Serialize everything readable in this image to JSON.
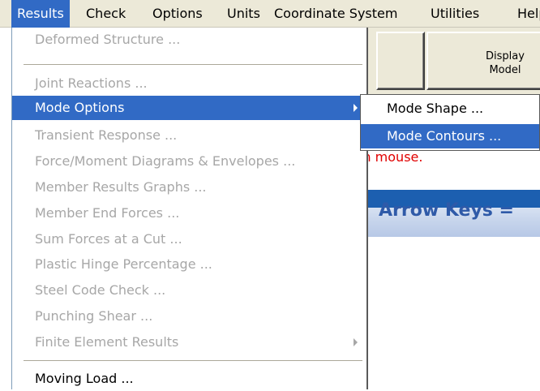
{
  "menubar": {
    "items": [
      "Results",
      "Check",
      "Options",
      "Units",
      "Coordinate System",
      "Utilities",
      "Help"
    ]
  },
  "toolbar": {
    "display_model_label_1": "Display",
    "display_model_label_2": "Model"
  },
  "hint": {
    "text": "m mouse."
  },
  "banner": {
    "text": "Arrow Keys ="
  },
  "results_menu": {
    "items": [
      {
        "label": "Deformed Structure ...",
        "enabled": false
      },
      {
        "label": "Joint Reactions ...",
        "enabled": false
      },
      {
        "label": "Mode Options",
        "enabled": true,
        "highlighted": true
      },
      {
        "label": "Transient Response ...",
        "enabled": false
      },
      {
        "label": "Force/Moment Diagrams & Envelopes ...",
        "enabled": false
      },
      {
        "label": "Member Results Graphs ...",
        "enabled": false
      },
      {
        "label": "Member End Forces ...",
        "enabled": false
      },
      {
        "label": "Sum Forces at a Cut ...",
        "enabled": false
      },
      {
        "label": "Plastic Hinge Percentage ...",
        "enabled": false
      },
      {
        "label": "Steel Code Check ...",
        "enabled": false
      },
      {
        "label": "Punching Shear ...",
        "enabled": false
      },
      {
        "label": "Finite Element Results",
        "enabled": false
      },
      {
        "label": "Moving Load ...",
        "enabled": true
      }
    ]
  },
  "mode_submenu": {
    "items": [
      {
        "label": "Mode Shape ..."
      },
      {
        "label": "Mode Contours ...",
        "highlighted": true
      }
    ]
  },
  "colors": {
    "highlight": "#316ac5",
    "disabled_text": "#a7a7a7",
    "menubar_bg": "#ece9d8",
    "hint_red": "#e00000"
  }
}
